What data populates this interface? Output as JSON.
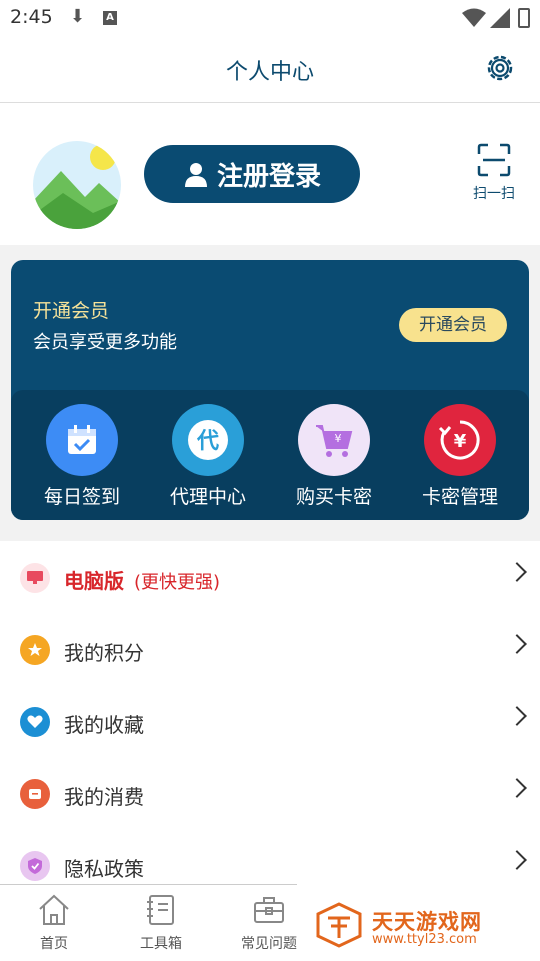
{
  "status_bar": {
    "time": "2:45"
  },
  "header": {
    "title": "个人中心"
  },
  "profile": {
    "login_label": "注册登录",
    "scan_label": "扫一扫"
  },
  "vip": {
    "title": "开通会员",
    "subtitle": "会员享受更多功能",
    "button": "开通会员"
  },
  "quick_actions": [
    {
      "label": "每日签到",
      "icon": "calendar-icon",
      "color": "#3d8cf5"
    },
    {
      "label": "代理中心",
      "icon": "agent-icon",
      "color": "#2a9fd8"
    },
    {
      "label": "购买卡密",
      "icon": "cart-icon",
      "color": "#f0e4f8"
    },
    {
      "label": "卡密管理",
      "icon": "refund-icon",
      "color": "#e0253e"
    }
  ],
  "menu": [
    {
      "label": "电脑版",
      "extra": "(更快更强)",
      "icon": "monitor-icon",
      "color": "#e84a5f"
    },
    {
      "label": "我的积分",
      "icon": "star-icon",
      "color": "#f5a623"
    },
    {
      "label": "我的收藏",
      "icon": "heart-icon",
      "color": "#1c8fd4"
    },
    {
      "label": "我的消费",
      "icon": "wallet-icon",
      "color": "#e8603c"
    },
    {
      "label": "隐私政策",
      "icon": "shield-icon",
      "color": "#c36ad9"
    }
  ],
  "tabs": [
    {
      "label": "首页",
      "icon": "home-icon"
    },
    {
      "label": "工具箱",
      "icon": "notebook-icon"
    },
    {
      "label": "常见问题",
      "icon": "briefcase-icon"
    }
  ],
  "watermark": {
    "title": "天天游戏网",
    "url": "www.ttyl23.com"
  }
}
